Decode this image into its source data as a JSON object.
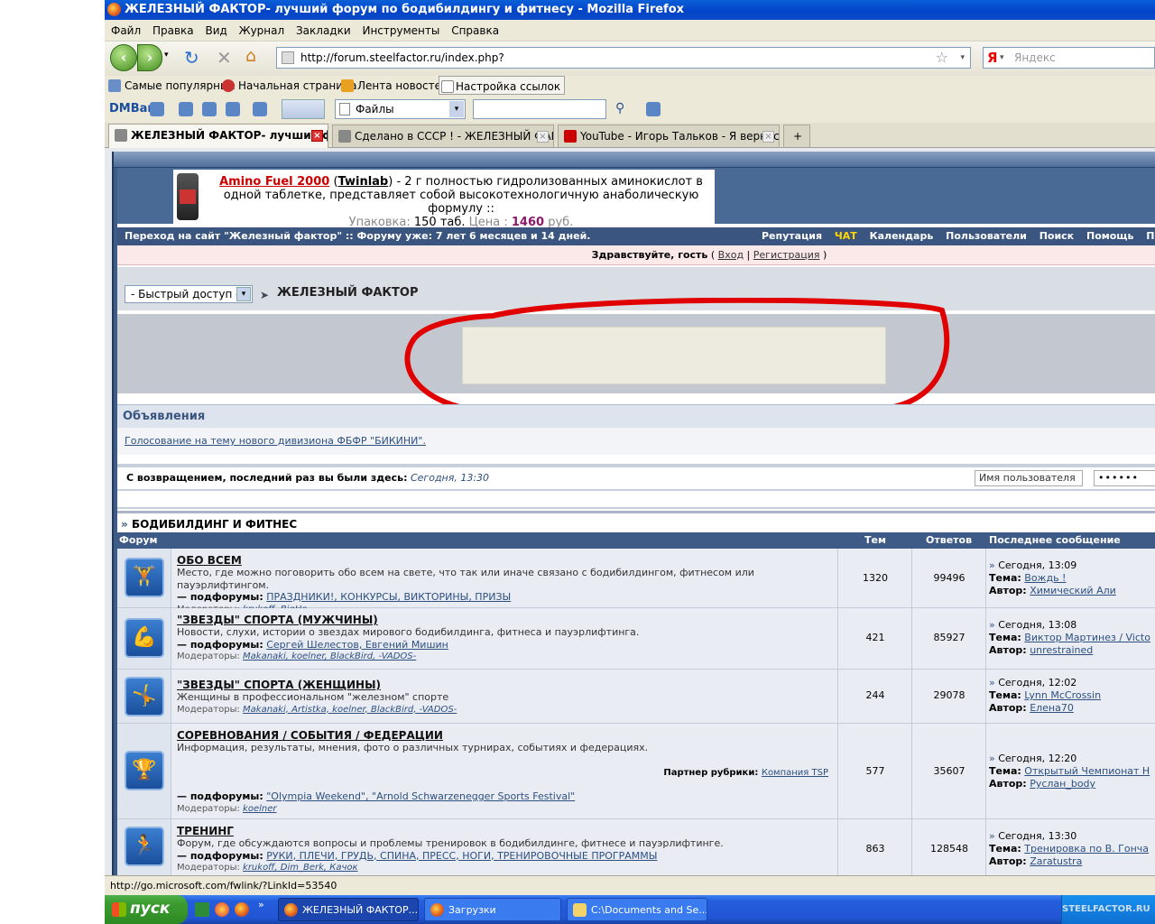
{
  "window": {
    "title": "ЖЕЛЕЗНЫЙ ФАКТОР- лучший форум по бодибилдингу и фитнесу - Mozilla Firefox"
  },
  "menu": [
    "Файл",
    "Правка",
    "Вид",
    "Журнал",
    "Закладки",
    "Инструменты",
    "Справка"
  ],
  "navigation": {
    "url": "http://forum.steelfactor.ru/index.php?",
    "search_placeholder": "Яндекс",
    "search_engine_letter": "Я"
  },
  "bookmarks": [
    "Самые популярные",
    "Начальная страница",
    "Лента новостей",
    "Настройка ссылок"
  ],
  "dmbar": {
    "logo": "DMBar",
    "select_value": "Файлы"
  },
  "tabs": [
    {
      "label": "ЖЕЛЕЗНЫЙ ФАКТОР- лучший фо...",
      "active": true
    },
    {
      "label": "Сделано в СССР ! - ЖЕЛЕЗНЫЙ ФАКТ...",
      "active": false
    },
    {
      "label": "YouTube - Игорь Тальков - Я вернусь...",
      "active": false
    }
  ],
  "ad": {
    "product": "Amino Fuel 2000",
    "brand": "Twinlab",
    "text": "- 2 г полностью гидролизованных аминокислот в одной таблетке, представляет собой высокотехнологичную анаболическую формулу ::",
    "pack_label": "Упаковка:",
    "pack_value": "150 таб.",
    "price_label": "Цена :",
    "price_value": "1460",
    "price_unit": "руб."
  },
  "topnav": {
    "left": "Переход на сайт \"Железный фактор\"   :: Форуму уже: 7 лет 6 месяцев и 14 дней.",
    "links": [
      "Репутация",
      "ЧАТ",
      "Календарь",
      "Пользователи",
      "Поиск",
      "Помощь",
      "Прав"
    ]
  },
  "greeting": {
    "text": "Здравствуйте, гость",
    "login": "Вход",
    "register": "Регистрация"
  },
  "breadcrumb": {
    "quick_access": "- Быстрый доступ -",
    "title": "ЖЕЛЕЗНЫЙ ФАКТОР"
  },
  "announcements": {
    "title": "Объявления",
    "link": "Голосование на тему нового дивизиона ФБФР \"БИКИНИ\"."
  },
  "welcome_back": {
    "text": "С возвращением, последний раз вы были здесь:",
    "time": "Сегодня, 13:30",
    "username_placeholder": "Имя пользователя",
    "password_mask": "••••••"
  },
  "category": {
    "title": "БОДИБИЛДИНГ И ФИТНЕС"
  },
  "table_headers": {
    "forum": "Форум",
    "topics": "Тем",
    "replies": "Ответов",
    "last": "Последнее сообщение"
  },
  "forums": [
    {
      "title": "ОБО ВСЕМ",
      "desc": "Место, где можно поговорить обо всем на свете, что так или иначе связано с бодибилдингом, фитнесом или пауэрлифтингом.",
      "sub_label": "— подфорумы:",
      "subforums": "ПРАЗДНИКИ!, КОНКУРСЫ, ВИКТОРИНЫ, ПРИЗЫ",
      "mods_label": "Модераторы:",
      "mods": "krukoff, BigHo",
      "topics": "1320",
      "replies": "99496",
      "last_date": "Сегодня, 13:09",
      "last_topic_label": "Тема:",
      "last_topic": "Вождь !",
      "last_author_label": "Автор:",
      "last_author": "Химический Али"
    },
    {
      "title": "\"ЗВЕЗДЫ\" СПОРТА (МУЖЧИНЫ)",
      "desc": "Новости, слухи, истории о звездах мирового бодибилдинга, фитнеса и пауэрлифтинга.",
      "sub_label": "— подфорумы:",
      "subforums": "Сергей Шелестов, Евгений Мишин",
      "mods_label": "Модераторы:",
      "mods": "Makanaki, koelner, BlackBird, -VADOS-",
      "topics": "421",
      "replies": "85927",
      "last_date": "Сегодня, 13:08",
      "last_topic_label": "Тема:",
      "last_topic": "Виктор Мартинез / Victo",
      "last_author_label": "Автор:",
      "last_author": "unrestrained"
    },
    {
      "title": "\"ЗВЕЗДЫ\" СПОРТА (ЖЕНЩИНЫ)",
      "desc": "Женщины в профессиональном \"железном\" спорте",
      "mods_label": "Модераторы:",
      "mods": "Makanaki, Artistka, koelner, BlackBird, -VADOS-",
      "topics": "244",
      "replies": "29078",
      "last_date": "Сегодня, 12:02",
      "last_topic_label": "Тема:",
      "last_topic": "Lynn McCrossin",
      "last_author_label": "Автор:",
      "last_author": "Елена70"
    },
    {
      "title": "СОРЕВНОВАНИЯ / СОБЫТИЯ / ФЕДЕРАЦИИ",
      "desc": "Информация, результаты, мнения, фото о различных турнирах, событиях и федерациях.",
      "partner_label": "Партнер рубрики:",
      "partner": "Компания TSP",
      "sub_label": "— подфорумы:",
      "subforums": "\"Olympia Weekend\", \"Arnold Schwarzenegger Sports Festival\"",
      "mods_label": "Модераторы:",
      "mods": "koelner",
      "topics": "577",
      "replies": "35607",
      "last_date": "Сегодня, 12:20",
      "last_topic_label": "Тема:",
      "last_topic": "Открытый Чемпионат Н",
      "last_author_label": "Автор:",
      "last_author": "Руслан_body"
    },
    {
      "title": "ТРЕНИНГ",
      "desc": "Форум, где обсуждаются вопросы и проблемы тренировок в бодибилдинге, фитнесе и пауэрлифтинге.",
      "sub_label": "— подфорумы:",
      "subforums": "РУКИ, ПЛЕЧИ, ГРУДЬ, СПИНА, ПРЕСС, НОГИ, ТРЕНИРОВОЧНЫЕ ПРОГРАММЫ",
      "mods_label": "Модераторы:",
      "mods": "krukoff, Dim_Berk, Качок",
      "topics": "863",
      "replies": "128548",
      "last_date": "Сегодня, 13:30",
      "last_topic_label": "Тема:",
      "last_topic": "Тренировка по В. Гонча",
      "last_author_label": "Автор:",
      "last_author": "Zaratustra"
    }
  ],
  "status": {
    "text": "http://go.microsoft.com/fwlink/?LinkId=53540"
  },
  "taskbar": {
    "start": "пуск",
    "tasks": [
      "ЖЕЛЕЗНЫЙ ФАКТОР...",
      "Загрузки",
      "C:\\Documents and Se..."
    ],
    "tray_text": "STEELFACTOR.RU"
  },
  "colors": {
    "accent": "#3e5b87",
    "annotation": "#e00000",
    "chat": "#ffd700",
    "price": "#8b1a6a"
  }
}
